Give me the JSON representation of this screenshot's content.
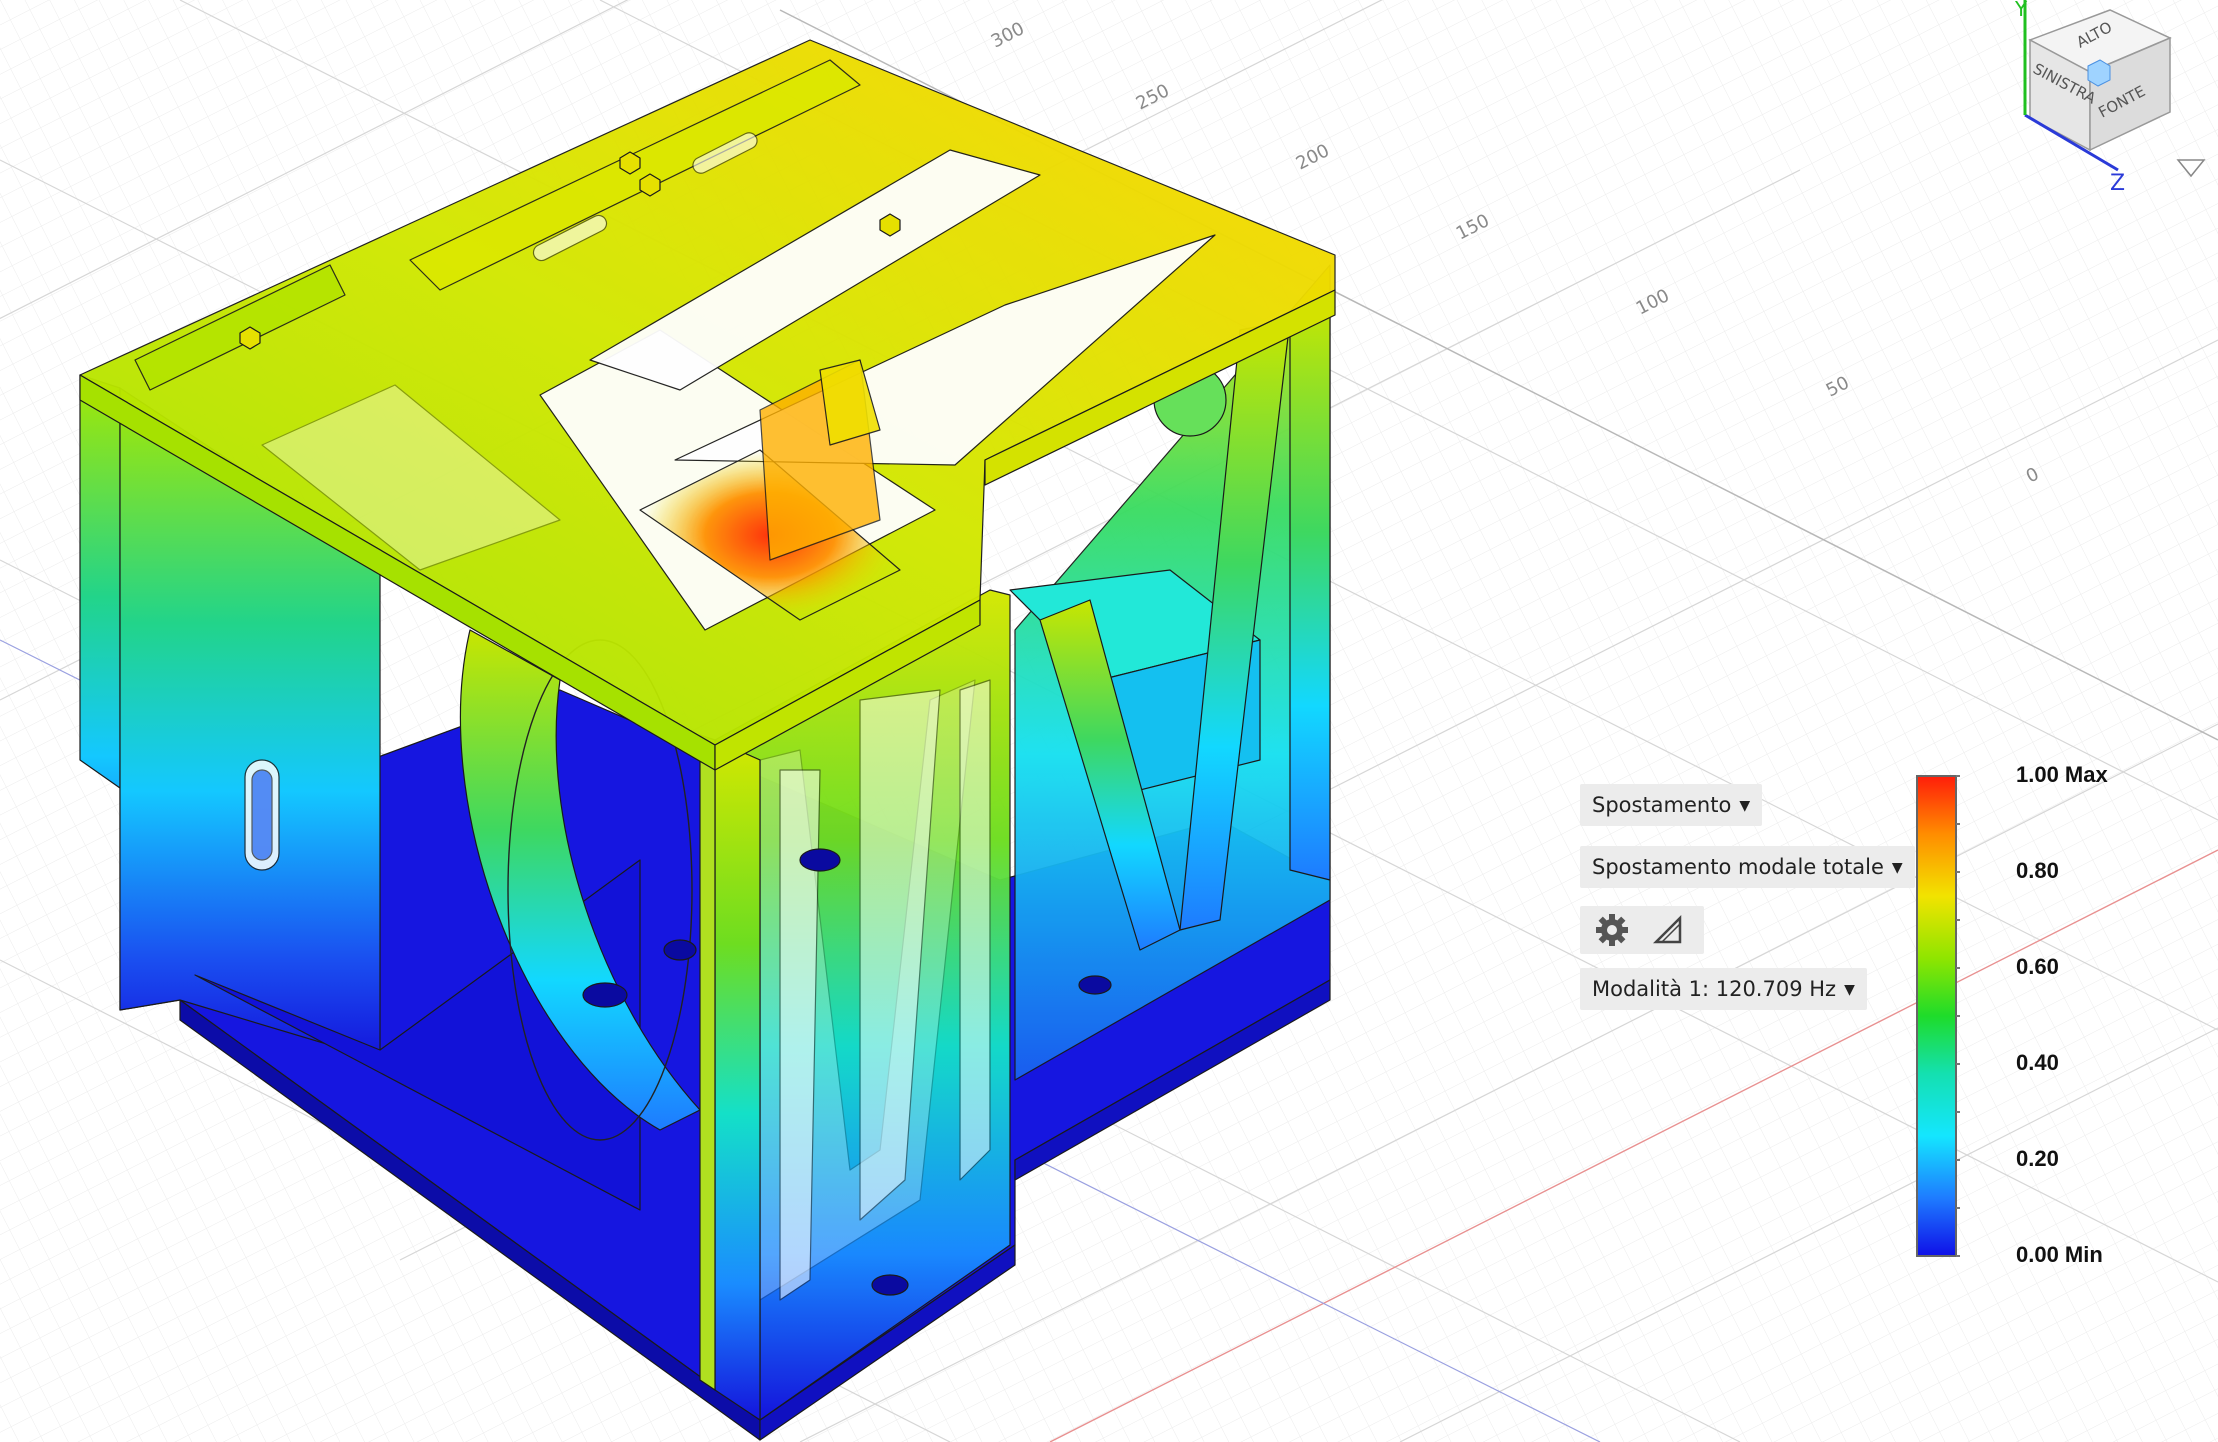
{
  "result_type": {
    "label": "Spostamento"
  },
  "result_component": {
    "label": "Spostamento modale totale"
  },
  "mode_selector": {
    "label": "Modalità 1: 120.709 Hz"
  },
  "legend": {
    "max_label": "1.00 Max",
    "ticks": [
      "0.80",
      "0.60",
      "0.40",
      "0.20"
    ],
    "min_label": "0.00 Min",
    "gradient": [
      "#ff1d0a",
      "#ff8c00",
      "#f2e300",
      "#8fe500",
      "#1edc2a",
      "#14e0b0",
      "#14e6ff",
      "#1e7bff",
      "#0f10e8"
    ]
  },
  "grid_axis_labels": [
    "300",
    "250",
    "200",
    "150",
    "100",
    "50",
    "0"
  ],
  "view_cube": {
    "face_top": "ALTO",
    "face_left": "SINISTRA",
    "face_front": "FONTE",
    "axis_y": "Y",
    "axis_z": "Z"
  },
  "colors": {
    "model_high": "#ff3b00",
    "model_mid": "#cde600",
    "model_low": "#1414dc",
    "axis_red": "#e04040",
    "axis_blue": "#2a3ad8",
    "axis_green": "#20c020"
  }
}
